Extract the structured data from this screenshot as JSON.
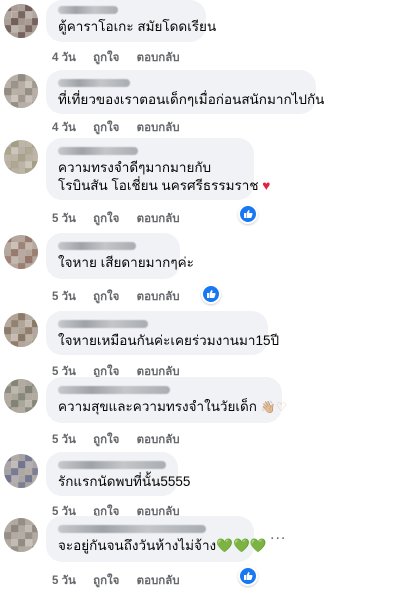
{
  "comments": [
    {
      "name": "",
      "text": "ตู้คาราโอเกะ สมัยโดดเรียน",
      "time": "4 วัน",
      "like": "ถูกใจ",
      "reply": "ตอบกลับ",
      "reaction": false
    },
    {
      "name": "",
      "text": "ที่เที่ยวของเราตอนเด็กๆเมื่อก่อนสนักมากไปกัน",
      "time": "4 วัน",
      "like": "ถูกใจ",
      "reply": "ตอบกลับ",
      "reaction": false
    },
    {
      "name": "",
      "text1": "ความทรงจำดีๆมากมายกับ",
      "text2": "โรบินสัน โอเชี่ยน นครศรีธรรมราช",
      "emoji": "♥",
      "time": "5 วัน",
      "like": "ถูกใจ",
      "reply": "ตอบกลับ",
      "reaction": true
    },
    {
      "name": "",
      "text": "ใจหาย เสียดายมากๆค่ะ",
      "time": "5 วัน",
      "like": "ถูกใจ",
      "reply": "ตอบกลับ",
      "reaction": true
    },
    {
      "name": "",
      "text": "ใจหายเหมือนกันค่ะเคยร่วมงานมา15ปี",
      "time": "5 วัน",
      "like": "ถูกใจ",
      "reply": "ตอบกลับ",
      "reaction": false
    },
    {
      "name": "",
      "text": "ความสุขและความทรงจำในวัยเด็ก",
      "emoji": "👋🏼♡",
      "time": "5 วัน",
      "like": "ถูกใจ",
      "reply": "ตอบกลับ",
      "reaction": false
    },
    {
      "name": "",
      "text": "รักแรกนัดพบที่นั้น5555",
      "time": "5 วัน",
      "like": "ถูกใจ",
      "reply": "ตอบกลับ",
      "reaction": false
    },
    {
      "name": "",
      "text": "จะอยู่กันจนถึงวันห้างไม่จ้าง",
      "emoji": "💚💚💚",
      "time": "5 วัน",
      "like": "ถูกใจ",
      "reply": "ตอบกลับ",
      "reaction": true,
      "more": "..."
    }
  ]
}
